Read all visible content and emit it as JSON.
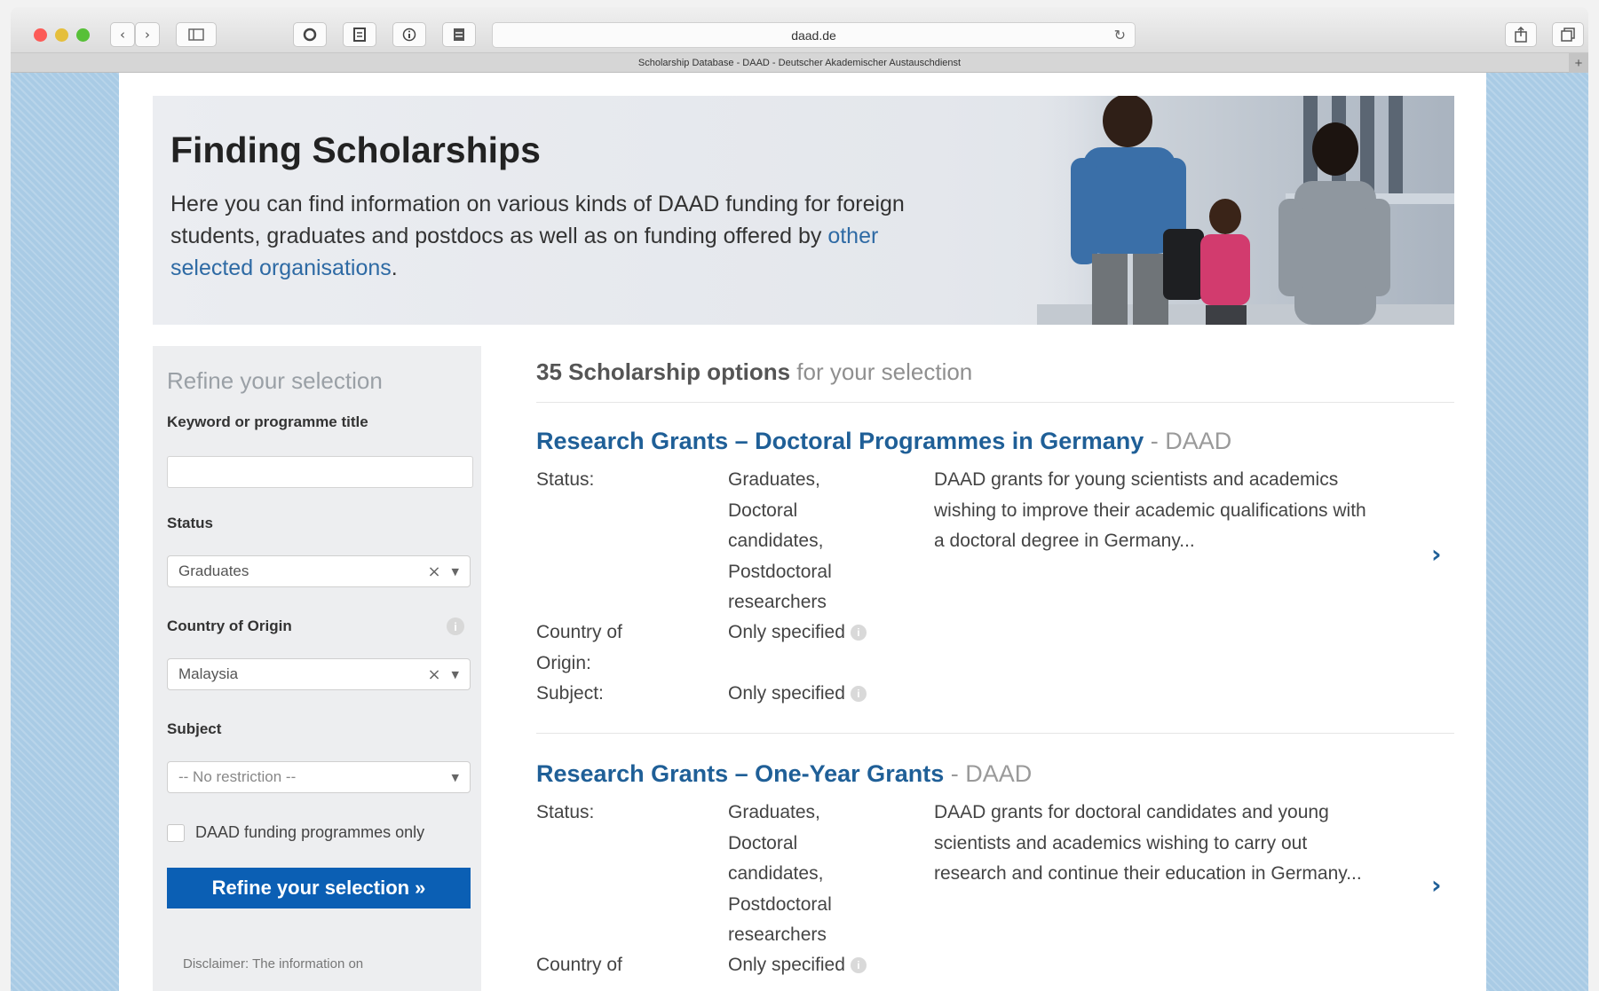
{
  "browser": {
    "url": "daad.de",
    "tab_title": "Scholarship Database - DAAD - Deutscher Akademischer Austauschdienst",
    "new_tab": "+"
  },
  "hero": {
    "title": "Finding Scholarships",
    "text": "Here you can find information on various kinds of DAAD funding for foreign students, graduates and postdocs as well as on funding offered by ",
    "link": "other selected organisations",
    "link_suffix": "."
  },
  "sidebar": {
    "heading": "Refine your selection",
    "keyword_label": "Keyword or programme title",
    "keyword_value": "",
    "status_label": "Status",
    "status_value": "Graduates",
    "country_label": "Country of Origin",
    "country_value": "Malaysia",
    "subject_label": "Subject",
    "subject_value": "-- No restriction --",
    "daad_only_label": "DAAD funding programmes only",
    "button_label": "Refine your selection »",
    "disclaimer": "Disclaimer: The information on"
  },
  "results": {
    "count": "35 Scholarship options",
    "count_suffix": " for your selection",
    "items": [
      {
        "title": "Research Grants – Doctoral Programmes in Germany",
        "org": " - DAAD",
        "status_label": "Status:",
        "status_lines": [
          "Graduates,",
          "Doctoral",
          "candidates,",
          "Postdoctoral",
          "researchers"
        ],
        "country_label_1": "Country of",
        "country_label_2": "Origin:",
        "country_value": "Only specified",
        "subject_label": "Subject:",
        "subject_value": "Only specified",
        "description": "DAAD grants for young scientists and academics wishing to improve their academic qualifications with a doctoral degree in Germany..."
      },
      {
        "title": "Research Grants – One-Year Grants",
        "org": " - DAAD",
        "status_label": "Status:",
        "status_lines": [
          "Graduates,",
          "Doctoral",
          "candidates,",
          "Postdoctoral",
          "researchers"
        ],
        "country_label_1": "Country of",
        "country_value": "Only specified",
        "description": "DAAD grants for doctoral candidates and young scientists and academics wishing to carry out research and continue their education in Germany..."
      }
    ]
  }
}
